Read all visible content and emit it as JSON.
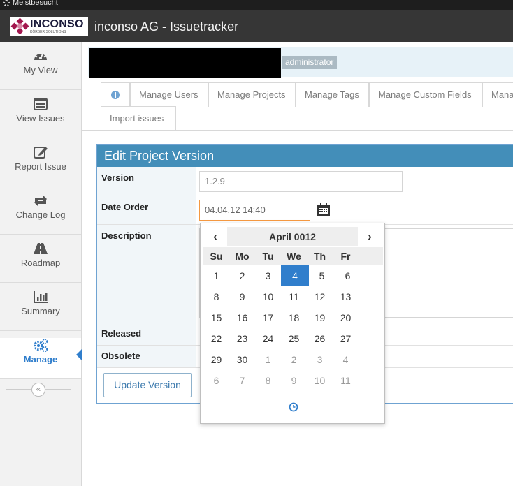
{
  "browser": {
    "bookmark_label": "Meistbesucht"
  },
  "app": {
    "logo_text": "INCONSO",
    "logo_subtext": "KÖRBER SOLUTIONS",
    "title": "inconso AG - Issuetracker"
  },
  "sidebar": {
    "items": [
      {
        "label": "My View",
        "icon": "dashboard-icon"
      },
      {
        "label": "View Issues",
        "icon": "list-icon"
      },
      {
        "label": "Report Issue",
        "icon": "edit-icon"
      },
      {
        "label": "Change Log",
        "icon": "retweet-icon"
      },
      {
        "label": "Roadmap",
        "icon": "road-icon"
      },
      {
        "label": "Summary",
        "icon": "bar-chart-icon"
      },
      {
        "label": "Manage",
        "icon": "gears-icon",
        "active": true
      }
    ],
    "collapse_glyph": "«"
  },
  "user": {
    "role_badge": "administrator"
  },
  "tabs": [
    "Manage Users",
    "Manage Projects",
    "Manage Tags",
    "Manage Custom Fields",
    "Mana",
    "Import issues"
  ],
  "form": {
    "title": "Edit Project Version",
    "version_label": "Version",
    "version_value": "1.2.9",
    "date_label": "Date Order",
    "date_value": "04.04.12 14:40",
    "description_label": "Description",
    "released_label": "Released",
    "obsolete_label": "Obsolete",
    "submit_label": "Update Version"
  },
  "datepicker": {
    "month_label": "April 0012",
    "prev": "‹",
    "next": "›",
    "weekdays": [
      "Su",
      "Mo",
      "Tu",
      "We",
      "Th",
      "Fr",
      "Sa"
    ],
    "weeks": [
      [
        "1",
        "2",
        "3",
        "4",
        "5",
        "6",
        "7"
      ],
      [
        "8",
        "9",
        "10",
        "11",
        "12",
        "13",
        "14"
      ],
      [
        "15",
        "16",
        "17",
        "18",
        "19",
        "20",
        "21"
      ],
      [
        "22",
        "23",
        "24",
        "25",
        "26",
        "27",
        "28"
      ],
      [
        "29",
        "30",
        "1",
        "2",
        "3",
        "4",
        "5"
      ],
      [
        "6",
        "7",
        "8",
        "9",
        "10",
        "11",
        "12"
      ]
    ],
    "selected_day": "4",
    "accent": "#307ecc"
  },
  "colors": {
    "navbar": "#363636",
    "panel_header": "#438eb9",
    "active": "#307ecc"
  }
}
